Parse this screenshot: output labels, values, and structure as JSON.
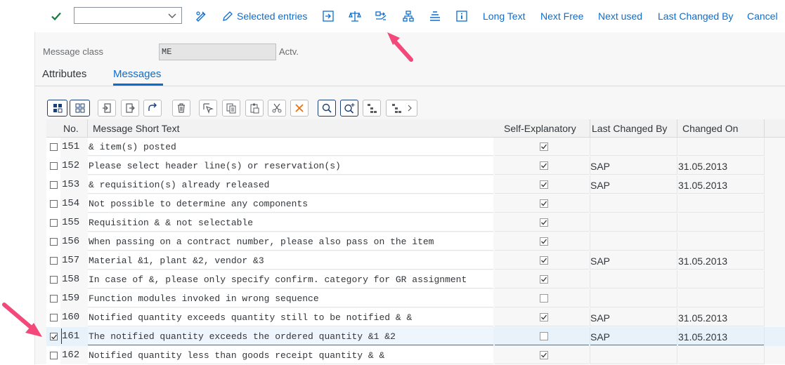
{
  "toolbar": {
    "confirm_icon": "checkmark-icon",
    "combo_value": "",
    "selected_entries": "Selected entries",
    "long_text": "Long Text",
    "next_free": "Next Free",
    "next_used": "Next used",
    "last_changed_by": "Last Changed By",
    "cancel": "Cancel"
  },
  "header": {
    "message_class_label": "Message class",
    "message_class_value": "ME",
    "status": "Actv."
  },
  "tabs": {
    "attributes": "Attributes",
    "messages": "Messages"
  },
  "columns": {
    "no": "No.",
    "short_text": "Message Short Text",
    "self_explanatory": "Self-Explanatory",
    "last_changed_by": "Last Changed By",
    "changed_on": "Changed On"
  },
  "rows": [
    {
      "no": "151",
      "text": "& item(s) posted",
      "self": true,
      "by": "",
      "on": "",
      "selected": false
    },
    {
      "no": "152",
      "text": "Please select header line(s) or reservation(s)",
      "self": true,
      "by": "SAP",
      "on": "31.05.2013",
      "selected": false
    },
    {
      "no": "153",
      "text": "& requisition(s) already released",
      "self": true,
      "by": "SAP",
      "on": "31.05.2013",
      "selected": false
    },
    {
      "no": "154",
      "text": "Not possible to determine any components",
      "self": true,
      "by": "",
      "on": "",
      "selected": false
    },
    {
      "no": "155",
      "text": "Requisition & & not selectable",
      "self": true,
      "by": "",
      "on": "",
      "selected": false
    },
    {
      "no": "156",
      "text": "When passing on a contract number, please also pass on the item",
      "self": true,
      "by": "",
      "on": "",
      "selected": false
    },
    {
      "no": "157",
      "text": "Material &1, plant &2, vendor &3",
      "self": true,
      "by": "SAP",
      "on": "31.05.2013",
      "selected": false
    },
    {
      "no": "158",
      "text": "In case of &, please only specify confirm. category for GR assignment",
      "self": true,
      "by": "",
      "on": "",
      "selected": false
    },
    {
      "no": "159",
      "text": "Function modules invoked in wrong sequence",
      "self": false,
      "by": "",
      "on": "",
      "selected": false
    },
    {
      "no": "160",
      "text": "Notified quantity exceeds quantity still to be notified & &",
      "self": true,
      "by": "SAP",
      "on": "31.05.2013",
      "selected": false
    },
    {
      "no": "161",
      "text": "The notified quantity exceeds the ordered quantity &1 &2",
      "self": false,
      "by": "SAP",
      "on": "31.05.2013",
      "selected": true
    },
    {
      "no": "162",
      "text": "Notified quantity less than goods receipt quantity & &",
      "self": true,
      "by": "",
      "on": "",
      "selected": false
    }
  ],
  "colors": {
    "accent": "#0a6ed1",
    "confirm": "#107e3e",
    "annotation_arrow": "#f2487a"
  }
}
